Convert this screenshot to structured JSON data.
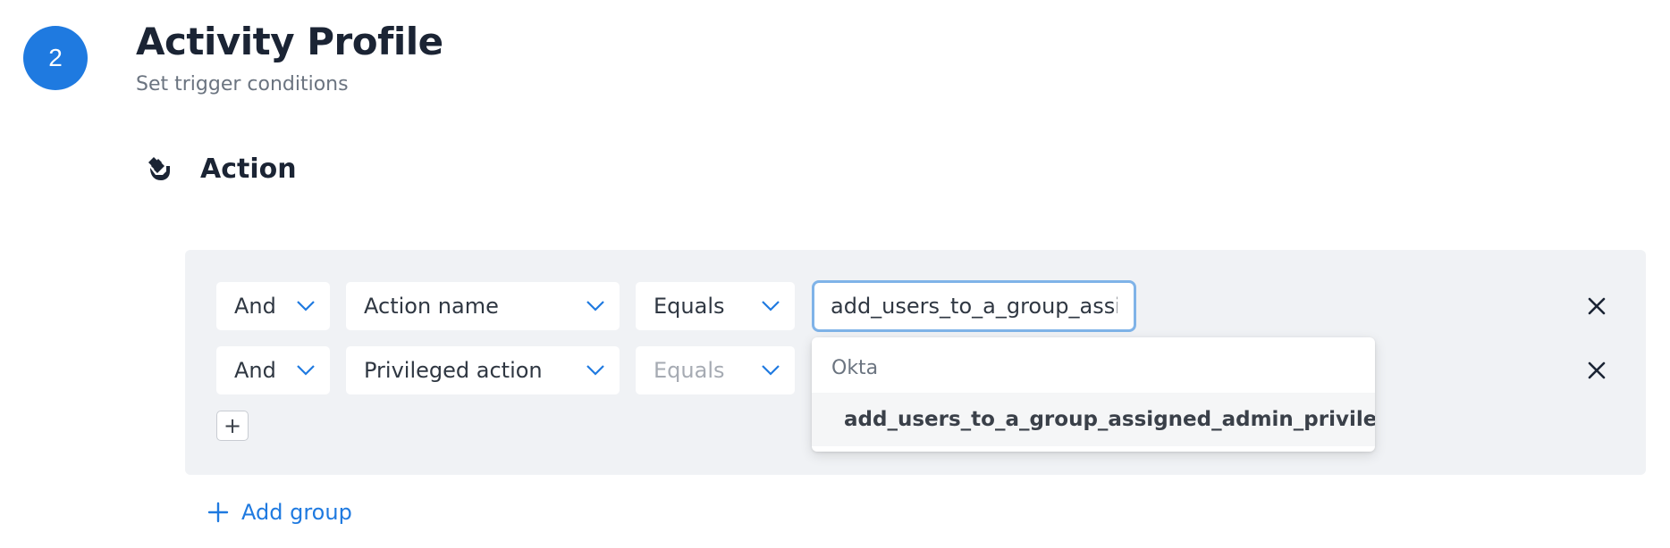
{
  "step": {
    "number": "2",
    "title": "Activity Profile",
    "subtitle": "Set trigger conditions"
  },
  "section": {
    "title": "Action",
    "icon": "hand-icon"
  },
  "rows": [
    {
      "connector": "And",
      "field": "Action name",
      "operator": "Equals",
      "value": "add_users_to_a_group_assign"
    },
    {
      "connector": "And",
      "field": "Privileged action",
      "operator": "Equals"
    }
  ],
  "dropdown": {
    "group_label": "Okta",
    "option": "add_users_to_a_group_assigned_admin_privileges"
  },
  "add_row_label": "+",
  "add_group_label": "Add group",
  "colors": {
    "accent": "#1f7ae0",
    "focus_border": "#7fb3e8",
    "panel_bg": "#f0f2f5"
  }
}
